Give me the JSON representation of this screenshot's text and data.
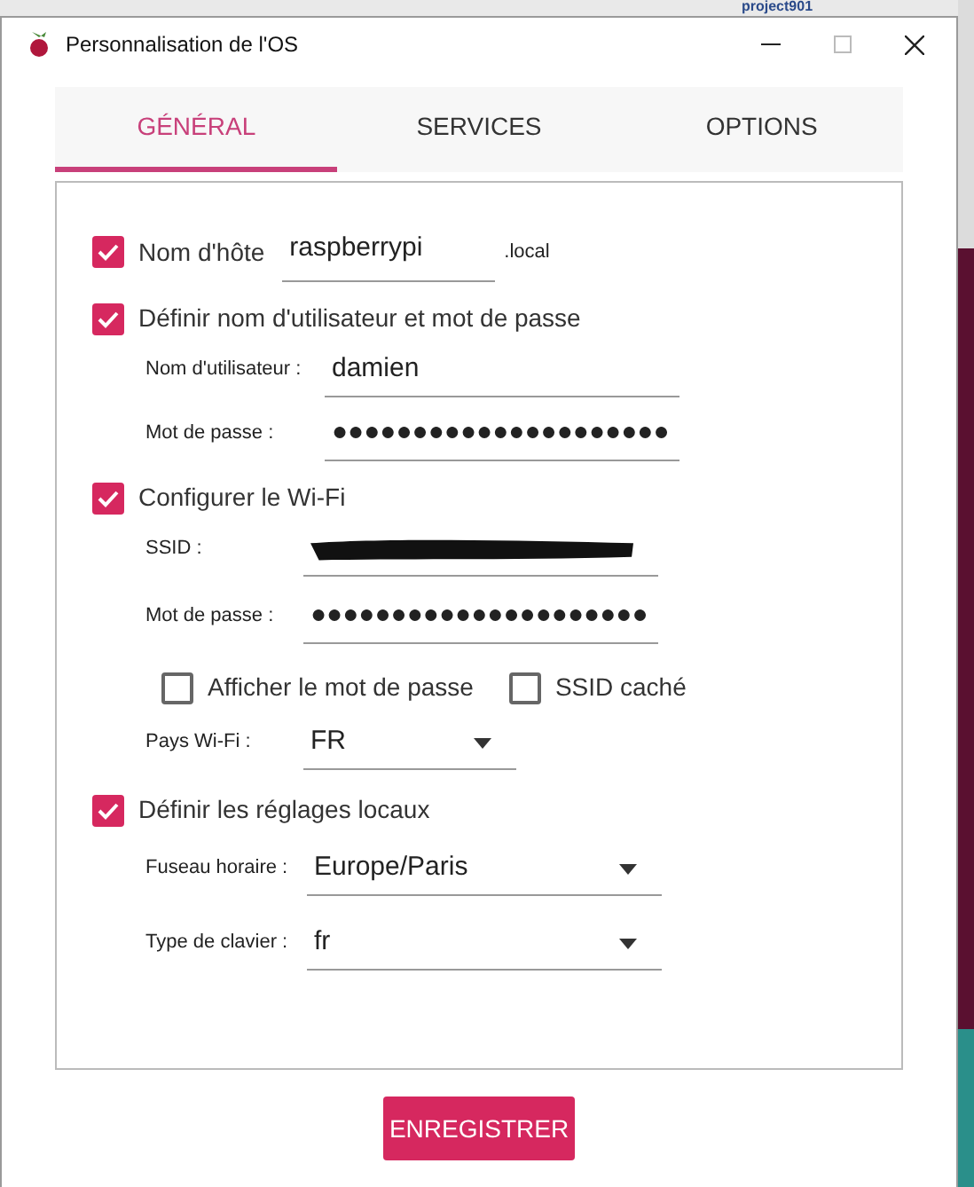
{
  "background": {
    "label": "project901"
  },
  "window": {
    "title": "Personnalisation de l'OS"
  },
  "tabs": [
    {
      "label": "GÉNÉRAL",
      "selected": true
    },
    {
      "label": "SERVICES",
      "selected": false
    },
    {
      "label": "OPTIONS",
      "selected": false
    }
  ],
  "hostname": {
    "label": "Nom d'hôte",
    "checked": true,
    "value": "raspberrypi",
    "suffix": ".local"
  },
  "user": {
    "label": "Définir nom d'utilisateur et mot de passe",
    "checked": true,
    "fields": [
      {
        "label": "Nom d'utilisateur :",
        "value": "damien"
      },
      {
        "label": "Mot de passe :",
        "value": "●●●●●●●●●●●●●●●●●●●●●"
      }
    ]
  },
  "wifi": {
    "label": "Configurer le Wi-Fi",
    "checked": true,
    "fields": [
      {
        "label": "SSID :",
        "redacted": true
      },
      {
        "label": "Mot de passe :",
        "value": "●●●●●●●●●●●●●●●●●●●●●"
      }
    ],
    "options": [
      {
        "label": "Afficher le mot de passe",
        "checked": false
      },
      {
        "label": "SSID caché",
        "checked": false
      }
    ],
    "country": {
      "label": "Pays Wi-Fi :",
      "value": "FR"
    }
  },
  "locale": {
    "label": "Définir les réglages locaux",
    "checked": true,
    "selects": [
      {
        "label": "Fuseau horaire :",
        "value": "Europe/Paris"
      },
      {
        "label": "Type de clavier :",
        "value": "fr"
      }
    ]
  },
  "save_button": "ENREGISTRER"
}
